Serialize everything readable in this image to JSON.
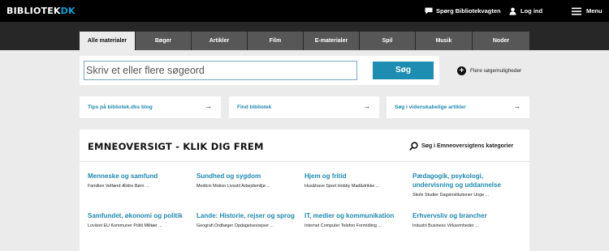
{
  "header": {
    "logo_main": "BIBLIOTEK",
    "logo_suffix": "DK",
    "ask_label": "Spørg Bibliotekvagten",
    "login_label": "Log ind",
    "menu_label": "Menu"
  },
  "tabs": [
    {
      "label": "Alle materialer",
      "active": true
    },
    {
      "label": "Bøger",
      "active": false
    },
    {
      "label": "Artikler",
      "active": false
    },
    {
      "label": "Film",
      "active": false
    },
    {
      "label": "E-materialer",
      "active": false
    },
    {
      "label": "Spil",
      "active": false
    },
    {
      "label": "Musik",
      "active": false
    },
    {
      "label": "Noder",
      "active": false
    }
  ],
  "search": {
    "placeholder": "Skriv et eller flere søgeord",
    "button_label": "Søg",
    "more_options": "Flere søgemuligheder"
  },
  "quick_links": [
    {
      "label": "Tips på bibliotek.dks blog",
      "arrow": "→"
    },
    {
      "label": "Find bibliotek",
      "arrow": "→"
    },
    {
      "label": "Søg i videnskabelige artikler",
      "arrow": "→"
    }
  ],
  "overview": {
    "title": "EMNEOVERSIGT - KLIK DIG FREM",
    "category_search": "Søg i Emneoversigtens kategorier",
    "subjects": [
      {
        "title": "Menneske og samfund",
        "sub": "Familien Velfærd Ældre Børn ..."
      },
      {
        "title": "Sundhed og sygdom",
        "sub": "Medicin Motion Livsstil Arbejdsmiljø ..."
      },
      {
        "title": "Hjem og fritid",
        "sub": "Hus&have Sport Hobby Mad&drikke ..."
      },
      {
        "title": "Pædagogik, psykologi, undervisning og uddannelse",
        "sub": "Skole Studier Dagsinstitutioner Unge ..."
      },
      {
        "title": "Samfundet, økonomi og politik",
        "sub": "Lovåret EU Kommuner Politi Militær ..."
      },
      {
        "title": "Lande: Historie, rejser og sprog",
        "sub": "Geografi Ordbøger Opdagelsesrejser ..."
      },
      {
        "title": "IT, medier og kommunikation",
        "sub": "Internet Computer Telefon Formidling ..."
      },
      {
        "title": "Erhvervsliv og brancher",
        "sub": "Industri Business Virksomheder ..."
      }
    ]
  }
}
